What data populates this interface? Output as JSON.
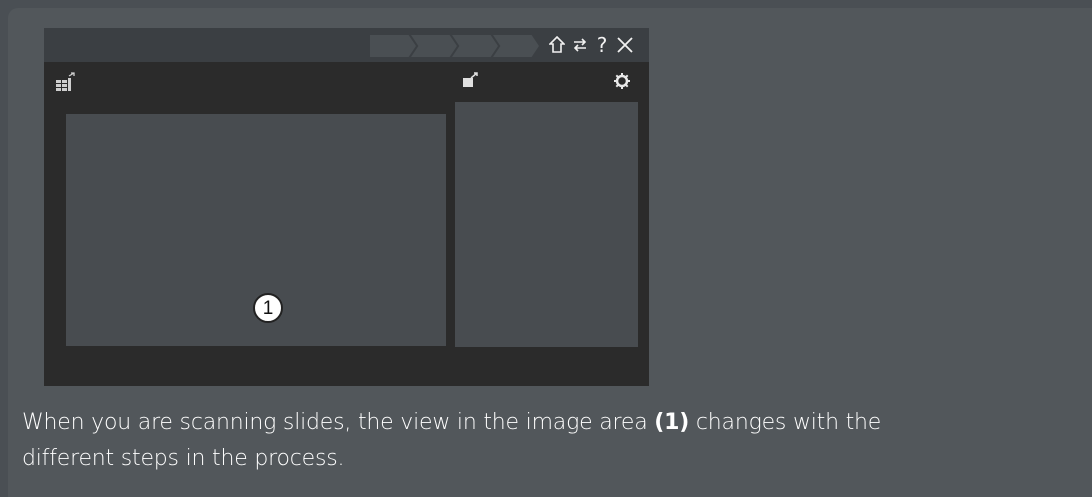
{
  "callout": {
    "number": "1"
  },
  "titlebar": {
    "icons": [
      "home-icon",
      "swap-icon",
      "help-icon",
      "close-icon"
    ],
    "home_glyph": "⌂",
    "swap_glyph": "⇄",
    "help_glyph": "?",
    "close_glyph": "✕"
  },
  "toolbar": {
    "left_icon": "slide-list-icon",
    "right_icons": [
      "slide-export-icon",
      "settings-gear-icon"
    ]
  },
  "caption": {
    "before": "When you are scanning slides, the view in the image area ",
    "ref": "(1)",
    "after_line1": " changes with the",
    "line2": "different steps in the process."
  },
  "colors": {
    "background": "#52575b",
    "app_background": "#2b2b2b",
    "panel_fill": "#484c50",
    "titlebar": "#3b3f43",
    "text": "#ffffff"
  }
}
